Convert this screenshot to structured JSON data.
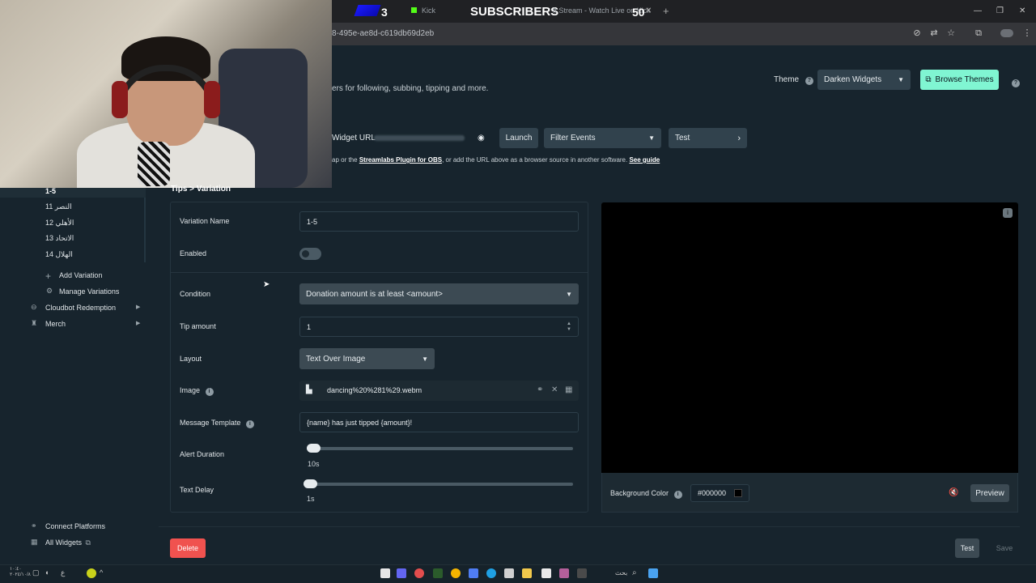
{
  "browser": {
    "tab_count": "3",
    "tab1_label": "Kick",
    "banner_text": "SUBSCRIBERS",
    "tab2_label": "ft Stream - Watch Live on Kick",
    "tab2_count": "50",
    "url": "8-495e-ae8d-c619db69d2eb"
  },
  "header": {
    "subtitle": "ers for following, subbing, tipping and more.",
    "theme_label": "Theme",
    "theme_value": "Darken Widgets",
    "browse_themes": "Browse Themes"
  },
  "widget_url": {
    "label": "Widget URL",
    "launch": "Launch",
    "filter_events": "Filter Events",
    "test": "Test",
    "guide_prefix": "ap or the ",
    "guide_link": "Streamlabs Plugin for OBS",
    "guide_mid": ", or add the URL above as a browser source in another software. ",
    "guide_see": "See guide"
  },
  "breadcrumb": "Tips > Variation",
  "sidebar": {
    "variations": [
      "1-5",
      "11 النصر",
      "12 الأهلي",
      "13 الاتحاد",
      "14 الهلال"
    ],
    "add_variation": "Add Variation",
    "manage_variations": "Manage Variations",
    "cloudbot": "Cloudbot Redemption",
    "merch": "Merch",
    "connect_platforms": "Connect Platforms",
    "all_widgets": "All Widgets"
  },
  "form": {
    "variation_name_label": "Variation Name",
    "variation_name_value": "1-5",
    "enabled_label": "Enabled",
    "condition_label": "Condition",
    "condition_value": "Donation amount is at least <amount>",
    "tip_amount_label": "Tip amount",
    "tip_amount_value": "1",
    "layout_label": "Layout",
    "layout_value": "Text Over Image",
    "image_label": "Image",
    "image_value": "dancing%20%281%29.webm",
    "message_template_label": "Message Template",
    "message_template_value": "{name} has just tipped {amount}!",
    "alert_duration_label": "Alert Duration",
    "alert_duration_value": "10s",
    "text_delay_label": "Text Delay",
    "text_delay_value": "1s"
  },
  "preview": {
    "background_color_label": "Background Color",
    "background_color_value": "#000000",
    "preview_button": "Preview"
  },
  "actions": {
    "delete": "Delete",
    "test": "Test",
    "save": "Save"
  },
  "taskbar": {
    "clock": "١٠:٤٠",
    "date": "٢٠٢٤/١٠/٨",
    "search": "بحث"
  },
  "colors": {
    "accent_teal": "#80f5d2",
    "danger": "#f0524f",
    "background": "#17242d"
  }
}
